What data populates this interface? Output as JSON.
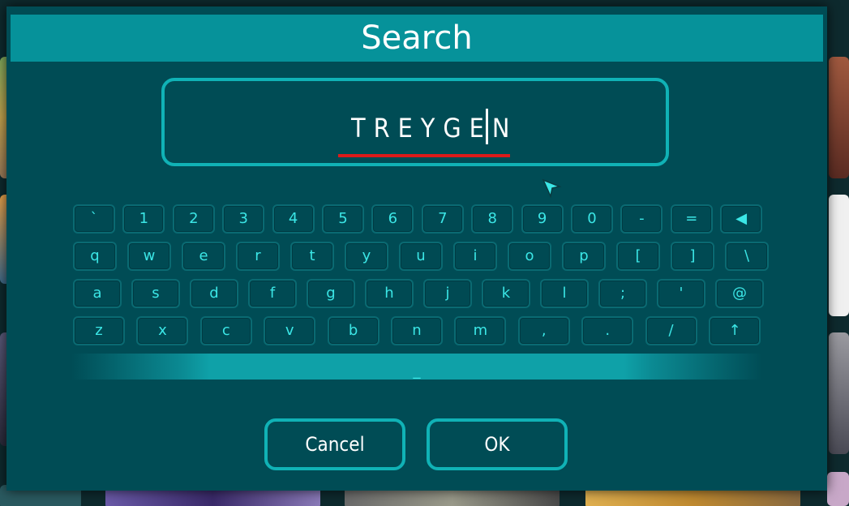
{
  "dialog": {
    "title": "Search",
    "input_value": "TREYGEN",
    "keyboard": {
      "row1": [
        "`",
        "1",
        "2",
        "3",
        "4",
        "5",
        "6",
        "7",
        "8",
        "9",
        "0",
        "-",
        "=",
        "◀"
      ],
      "row2": [
        "q",
        "w",
        "e",
        "r",
        "t",
        "y",
        "u",
        "i",
        "o",
        "p",
        "[",
        "]",
        "\\"
      ],
      "row3": [
        "a",
        "s",
        "d",
        "f",
        "g",
        "h",
        "j",
        "k",
        "l",
        ";",
        "'",
        "@"
      ],
      "row4": [
        "z",
        "x",
        "c",
        "v",
        "b",
        "n",
        "m",
        ",",
        ".",
        "/",
        "↑"
      ],
      "space_label": "_"
    },
    "buttons": {
      "cancel": "Cancel",
      "ok": "OK"
    }
  },
  "colors": {
    "dialog_bg": "#004c55",
    "title_bar": "#06929a",
    "key_text": "#3be6e6",
    "border_accent": "#10b2b6",
    "text_underline": "#dd1a1a"
  }
}
